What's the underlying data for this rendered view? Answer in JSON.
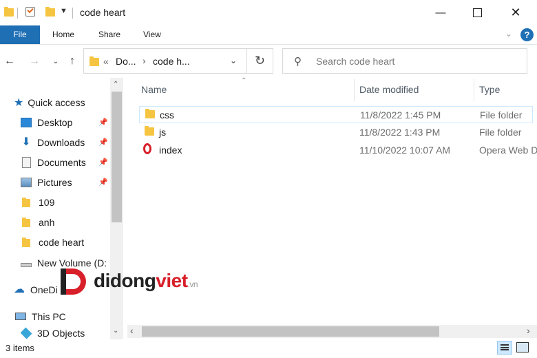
{
  "window": {
    "title": "code heart"
  },
  "ribbon": {
    "tabs": [
      "File",
      "Home",
      "Share",
      "View"
    ]
  },
  "address": {
    "path": [
      "Do...",
      "code h..."
    ],
    "overflow": "«"
  },
  "search": {
    "placeholder": "Search code heart"
  },
  "sidebar": {
    "quick_access": "Quick access",
    "items": [
      {
        "label": "Desktop",
        "icon": "desktop-icon",
        "pinned": true
      },
      {
        "label": "Downloads",
        "icon": "downloads-icon",
        "pinned": true
      },
      {
        "label": "Documents",
        "icon": "documents-icon",
        "pinned": true
      },
      {
        "label": "Pictures",
        "icon": "pictures-icon",
        "pinned": true
      },
      {
        "label": "109",
        "icon": "folder-icon",
        "pinned": false
      },
      {
        "label": "anh",
        "icon": "folder-icon",
        "pinned": false
      },
      {
        "label": "code heart",
        "icon": "folder-icon",
        "pinned": false
      },
      {
        "label": "New Volume (D:",
        "icon": "drive-icon",
        "pinned": false
      }
    ],
    "onedrive": "OneDi",
    "this_pc": "This PC",
    "objects3d": "3D Objects"
  },
  "columns": {
    "name": "Name",
    "date": "Date modified",
    "type": "Type"
  },
  "files": [
    {
      "name": "css",
      "date": "11/8/2022 1:45 PM",
      "type": "File folder",
      "icon": "folder-icon"
    },
    {
      "name": "js",
      "date": "11/8/2022 1:43 PM",
      "type": "File folder",
      "icon": "folder-icon"
    },
    {
      "name": "index",
      "date": "11/10/2022 10:07 AM",
      "type": "Opera Web D",
      "icon": "opera-icon"
    }
  ],
  "status": {
    "items": "3 items"
  },
  "watermark": {
    "brand_main": "didong",
    "brand_accent": "viet",
    "brand_suffix": ".vn"
  },
  "colors": {
    "accent": "#1f6fb5",
    "folder": "#f5c542",
    "opera": "#d8202a",
    "selection": "#cde8ff"
  }
}
